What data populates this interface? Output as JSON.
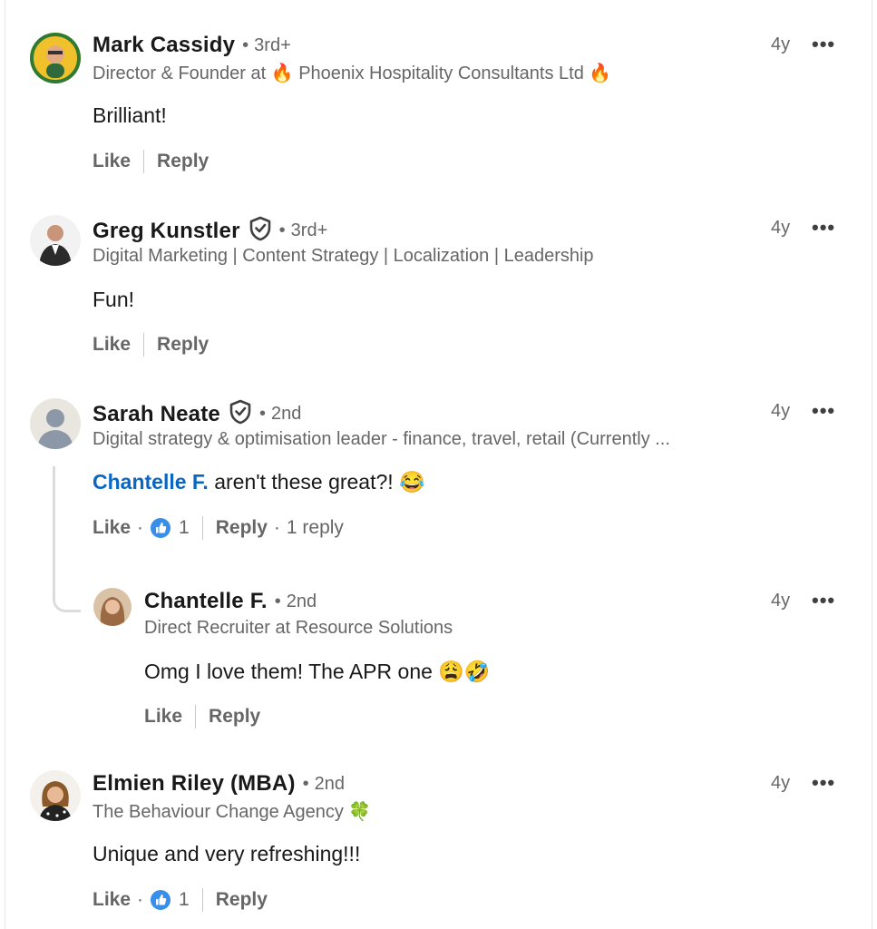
{
  "comments": [
    {
      "name": "Mark Cassidy",
      "degree": "3rd+",
      "headline": "Director & Founder at 🔥 Phoenix Hospitality Consultants Ltd 🔥",
      "text": "Brilliant!",
      "time": "4y",
      "actions": {
        "like": "Like",
        "reply": "Reply"
      }
    },
    {
      "name": "Greg Kunstler",
      "degree": "3rd+",
      "headline": "Digital Marketing | Content Strategy | Localization | Leadership",
      "text": "Fun!",
      "time": "4y",
      "actions": {
        "like": "Like",
        "reply": "Reply"
      }
    },
    {
      "name": "Sarah Neate",
      "degree": "2nd",
      "headline": "Digital strategy & optimisation leader - finance, travel, retail (Currently ...",
      "mention": "Chantelle F.",
      "text": " aren't these great?! 😂",
      "time": "4y",
      "actions": {
        "like": "Like",
        "reactions": "1",
        "reply": "Reply",
        "replies": "1 reply"
      }
    },
    {
      "name": "Chantelle F.",
      "degree": "2nd",
      "headline": "Direct Recruiter at Resource Solutions",
      "text": "Omg I love them! The APR one 😩🤣",
      "time": "4y",
      "actions": {
        "like": "Like",
        "reply": "Reply"
      }
    },
    {
      "name": "Elmien Riley (MBA)",
      "degree": "2nd",
      "headline": "The Behaviour Change Agency 🍀",
      "text": "Unique and very refreshing!!!",
      "time": "4y",
      "actions": {
        "like": "Like",
        "reactions": "1",
        "reply": "Reply"
      }
    }
  ],
  "icons": {
    "more": "more-options-icon",
    "verified": "verified-shield-icon",
    "like_reaction": "like-reaction-icon"
  },
  "colors": {
    "accent": "#0a66c2",
    "muted": "#666666",
    "text": "#191919"
  }
}
